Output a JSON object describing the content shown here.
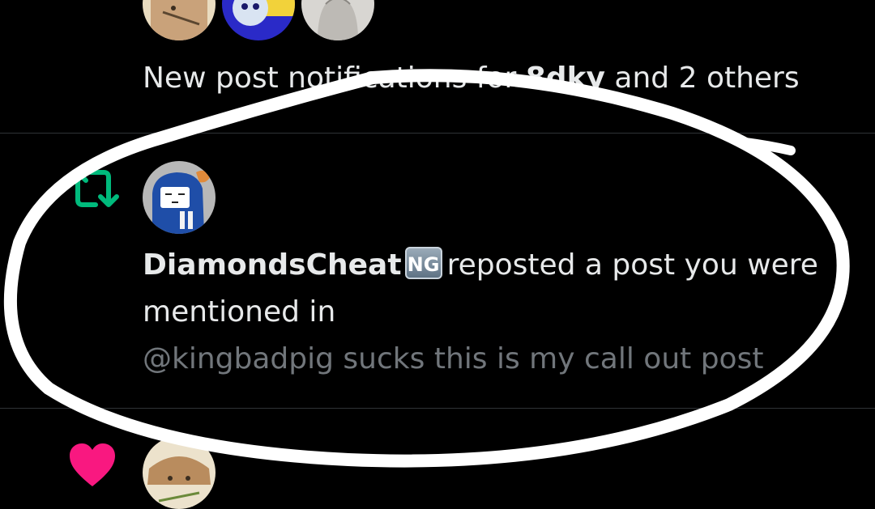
{
  "colors": {
    "background": "#000000",
    "text_primary": "#e7e9ea",
    "text_secondary": "#71767b",
    "bell": "#1d9bf0",
    "repost": "#00ba7c",
    "like": "#f91880",
    "divider": "#2f3336"
  },
  "notifications": [
    {
      "type": "new-post",
      "icon": "bell-icon",
      "text_prefix": "New post notifications for ",
      "username": "8dky",
      "text_suffix": " and 2 others"
    },
    {
      "type": "repost",
      "icon": "repost-icon",
      "actor_name": "DiamondsCheat",
      "actor_badge": "NG",
      "action": "reposted a post you were mentioned in",
      "post_preview": "@kingbadpig sucks this is my call out post"
    },
    {
      "type": "like",
      "icon": "heart-icon"
    }
  ]
}
